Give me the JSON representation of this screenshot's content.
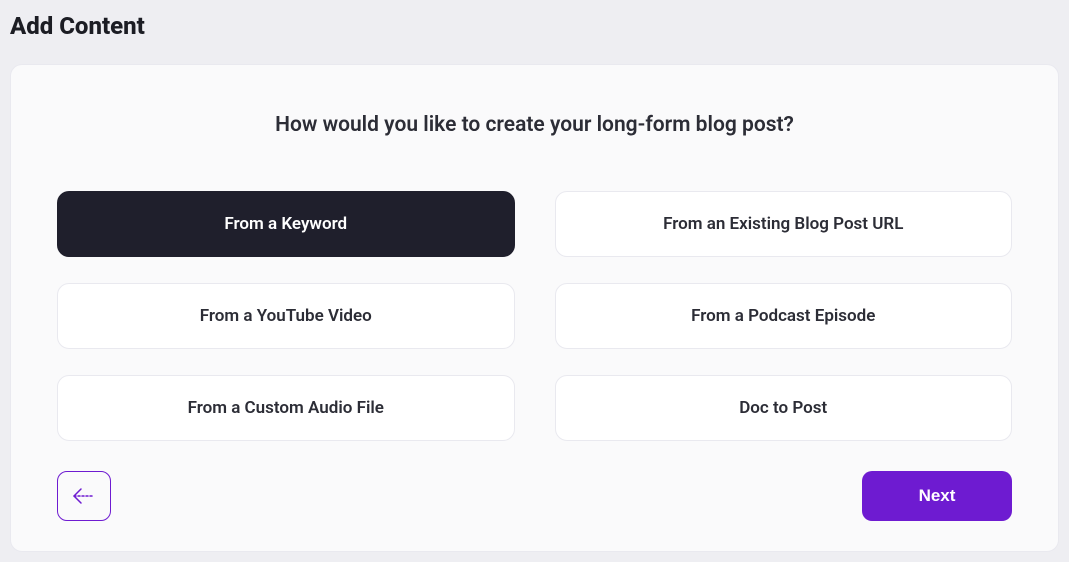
{
  "page_title": "Add Content",
  "heading": "How would you like to create your long-form blog post?",
  "options": {
    "0": {
      "label": "From a Keyword",
      "selected": true
    },
    "1": {
      "label": "From an Existing Blog Post URL",
      "selected": false
    },
    "2": {
      "label": "From a YouTube Video",
      "selected": false
    },
    "3": {
      "label": "From a Podcast Episode",
      "selected": false
    },
    "4": {
      "label": "From a Custom Audio File",
      "selected": false
    },
    "5": {
      "label": "Doc to Post",
      "selected": false
    }
  },
  "buttons": {
    "next": "Next"
  },
  "colors": {
    "accent": "#6e1bd1",
    "dark": "#1f1f2c",
    "background": "#eeeef2"
  }
}
